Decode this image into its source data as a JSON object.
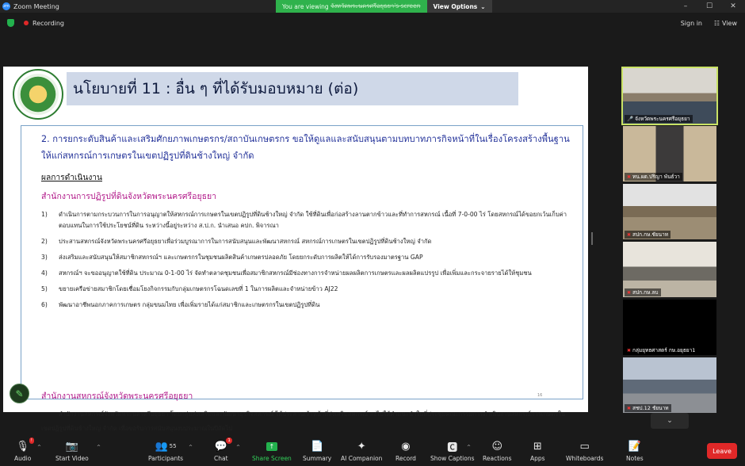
{
  "window": {
    "title": "Zoom Meeting",
    "controls": [
      "–",
      "☐",
      "✕"
    ]
  },
  "banner": {
    "viewing_prefix": "You are viewing",
    "viewing_name": "จังหวัดพระนครศรีอยุธยา's screen",
    "view_options": "View Options"
  },
  "topbar": {
    "recording": "Recording",
    "sign_in": "Sign in",
    "view": "View"
  },
  "slide": {
    "title": "นโยบายที่ 11 :  อื่น ๆ ที่ได้รับมอบหมาย (ต่อ)",
    "heading": "2. การยกระดับสินค้าและเสริมศักยภาพเกษตรกร/สถาบันเกษตรกร ขอให้ดูแลและสนับสนุนตามบทบาทภารกิจหน้าที่ในเรื่องโครงสร้างพื้นฐานให้แก่สหกรณ์การเกษตรในเขตปฏิรูปที่ดินช้างใหญ่ จำกัด",
    "result_label": "ผลการดำเนินงาน",
    "office1": "สำนักงานการปฏิรูปที่ดินจังหวัดพระนครศรีอยุธยา",
    "items": [
      {
        "num": "1)",
        "text": "ดำเนินการตามกระบวนการในการอนุญาตให้สหกรณ์การเกษตรในเขตปฏิรูปที่ดินช้างใหญ่ จำกัด ใช้ที่ดินเพื่อก่อสร้างลานตากข้าวและที่ทำการสหกรณ์ เนื้อที่ 7-0-00 ไร่ โดยสหกรณ์ได้ขอยกเว้นเก็บค่าตอบแทนในการใช้ประโยชน์ที่ดิน ระหว่างนี้อยู่ระหว่าง ส.ป.ก. นำเสนอ คปก. พิจารณา"
      },
      {
        "num": "2)",
        "text": "ประสานสหกรณ์จังหวัดพระนครศรีอยุธยาเพื่อร่วมบูรณาการในการสนับสนุนและพัฒนาสหกรณ์ สหกรณ์การเกษตรในเขตปฏิรูปที่ดินช้างใหญ่ จำกัด"
      },
      {
        "num": "3)",
        "text": "ส่งเสริมและสนับสนุนให้สมาชิกสหกรณ์ฯ และเกษตรกรในชุมชนผลิตสินค้าเกษตรปลอดภัย โดยยกระดับการผลิตให้ได้การรับรองมาตรฐาน GAP"
      },
      {
        "num": "4)",
        "text": "สหกรณ์ฯ จะขออนุญาตใช้ที่ดิน ประมาณ 0-1-00 ไร่ จัดทำตลาดชุมชนเพื่อสมาชิกสหกรณ์มีช่องทางการจำหน่ายผลผลิตการเกษตรและผลผลิตแปรรูป เพื่อเพิ่มและกระจายรายได้ให้ชุมชน"
      },
      {
        "num": "5)",
        "text": "ขยายเครือข่ายสมาชิกโดยเชื่อมโยงกิจกรรมกับกลุ่มเกษตรกรโฉนดเลขที่ 1 ในการผลิตและจำหน่ายข้าว AJ22"
      },
      {
        "num": "6)",
        "text": "พัฒนาอาชีพนอกภาคการเกษตร กลุ่มขนมไทย เพื่อเพิ่มรายได้แก่สมาชิกและเกษตรกรในเขตปฏิรูปที่ดิน"
      }
    ],
    "office2": "สำนักงานสหกรณ์จังหวัดพระนครศรีอยุธยา",
    "paragraph": "สำนักงานสหกรณ์จังหวัดพระนครศรีอยุธยา โดยกลุ่มส่งเสริมและพัฒนาธุรกิจสหกรณ์ ได้ประสานเจ้าหน้าที่ส่งเสริมสหกรณ์ ลงไปให้คำแนะนำในที่ประชุมคณะกรรมการดำเนินงานสหกรณ์การเกษตรในเขตปฏิรูปที่ดินช้างใหญ่ จำกัด เพื่อขอรับการสนับสนุนงบประมาณในปีถัดไป",
    "page_number": "16"
  },
  "participants_gallery": [
    {
      "name": "จังหวัดพระนครศรีอยุธยา",
      "muted": false,
      "active": true
    },
    {
      "name": "ทน.ผต.ปริญา พันธ์วา",
      "muted": true,
      "active": false
    },
    {
      "name": "สปก.กษ.ชัยนาท",
      "muted": true,
      "active": false
    },
    {
      "name": "สปก.กษ.ลบ",
      "muted": true,
      "active": false
    },
    {
      "name": "กลุ่มยุทธศาสตร์ กษ.อยุธยา1",
      "muted": true,
      "active": false
    },
    {
      "name": "สชป.12 ชัยนาท",
      "muted": true,
      "active": false
    }
  ],
  "toolbar": {
    "audio": "Audio",
    "start_video": "Start Video",
    "participants": "Participants",
    "participants_count": "55",
    "chat": "Chat",
    "chat_badge": "1",
    "share_screen": "Share Screen",
    "summary": "Summary",
    "ai_companion": "AI Companion",
    "record": "Record",
    "show_captions": "Show Captions",
    "reactions": "Reactions",
    "apps": "Apps",
    "whiteboards": "Whiteboards",
    "notes": "Notes",
    "leave": "Leave"
  },
  "colors": {
    "accent_green": "#23b14d",
    "leave_red": "#e02828",
    "active_speaker": "#c9e265",
    "slide_heading": "#24339a",
    "office_magenta": "#b21a8a"
  }
}
